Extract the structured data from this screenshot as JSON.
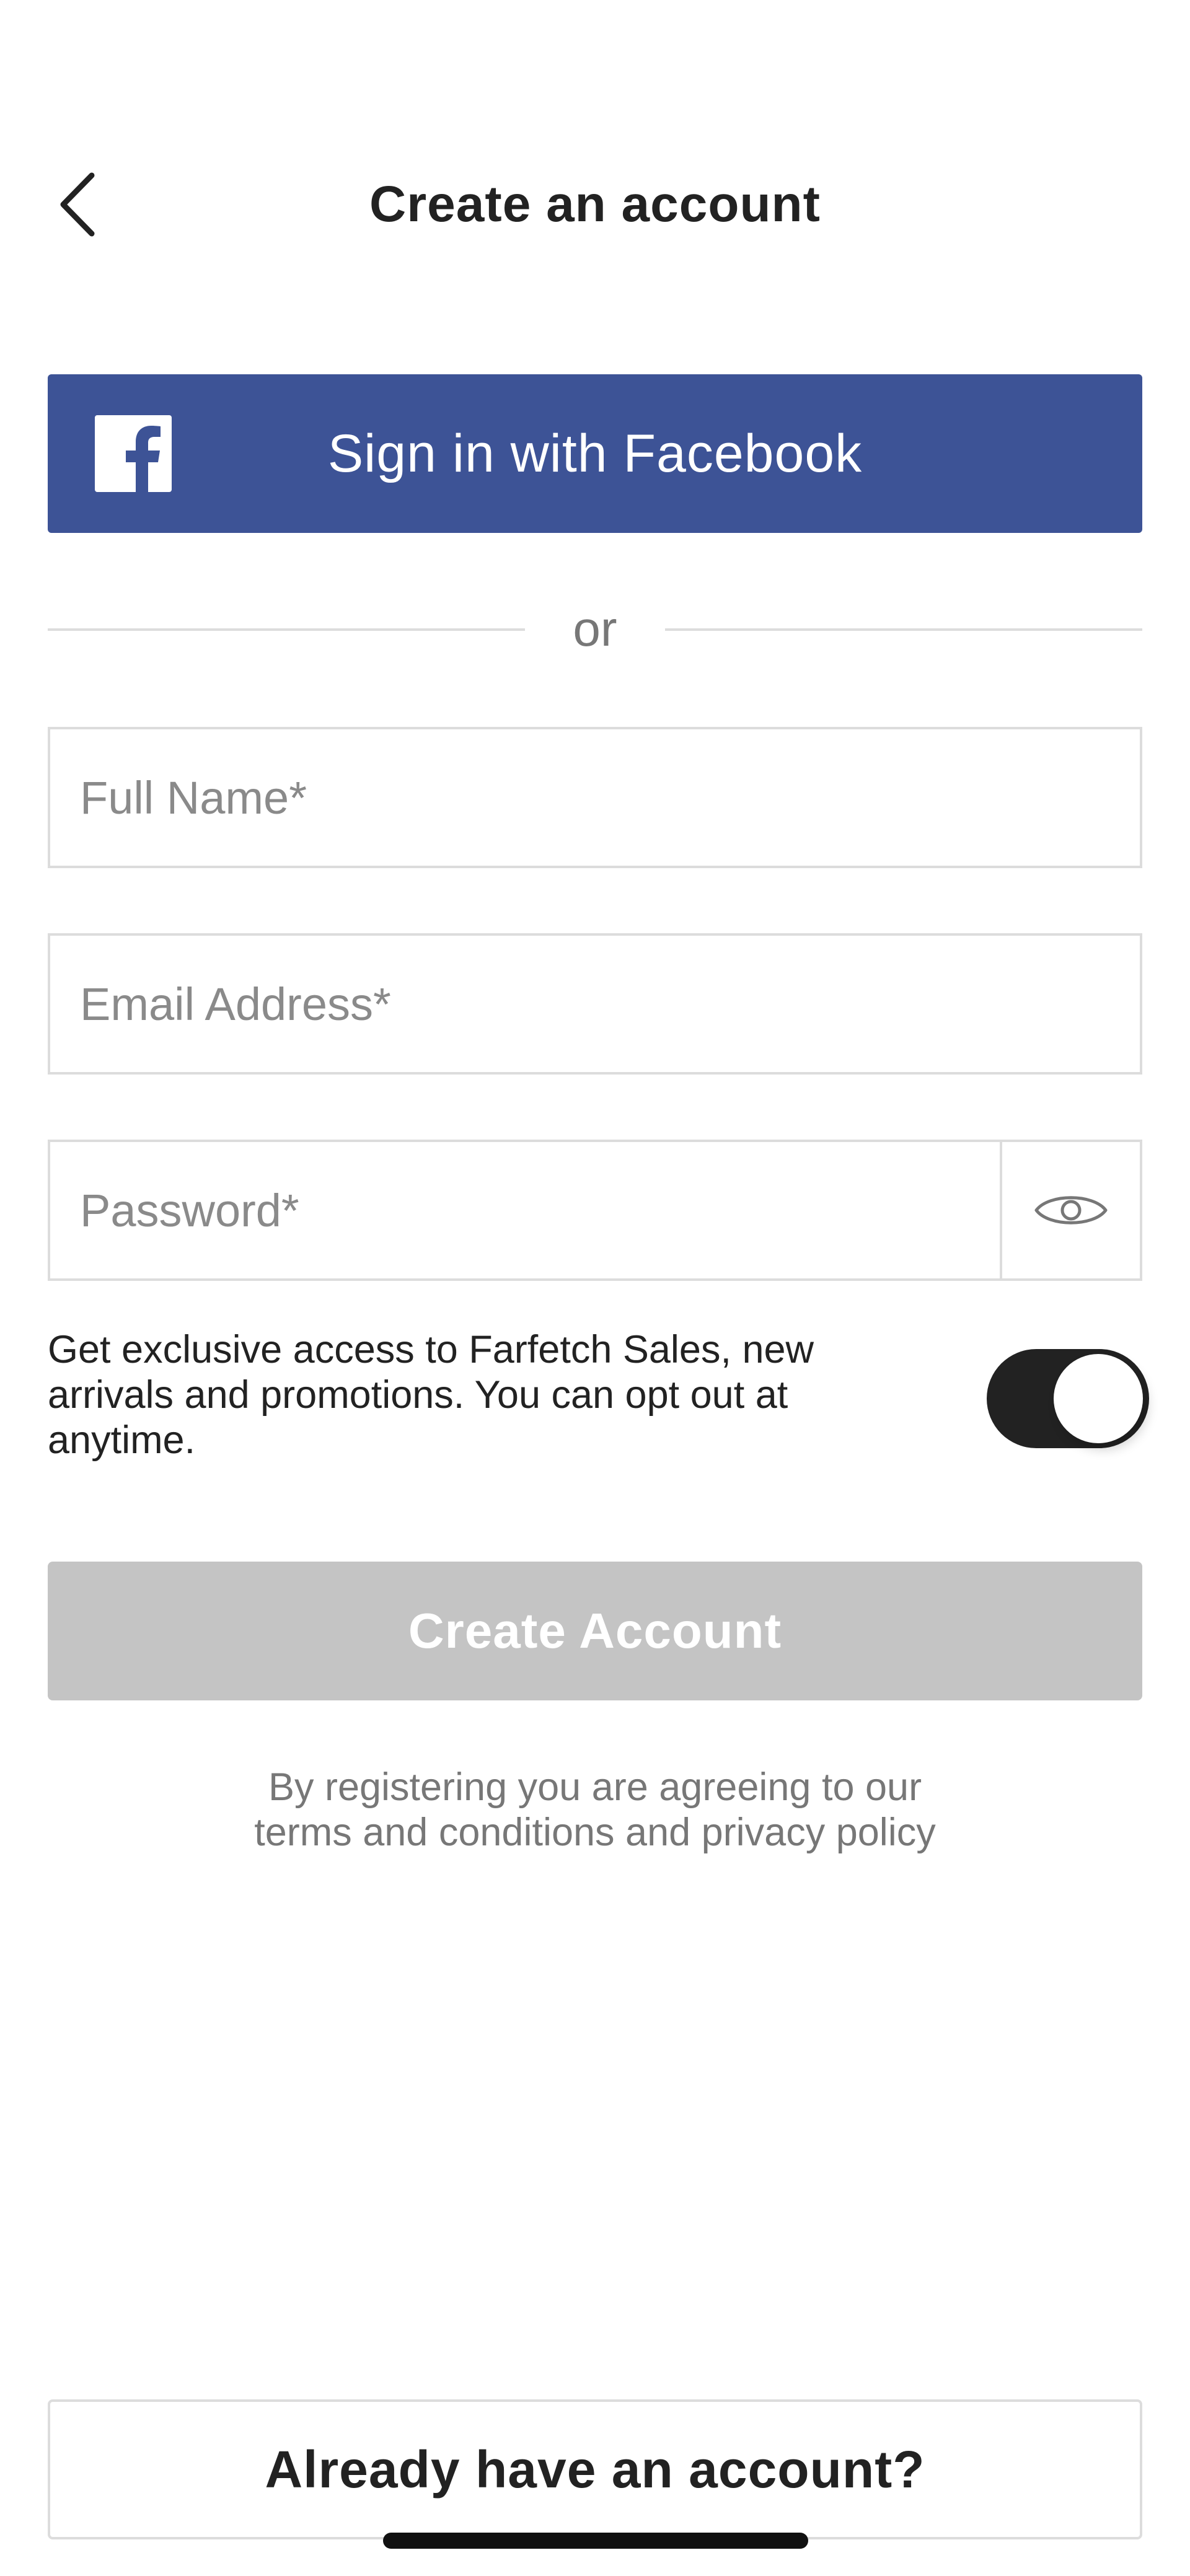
{
  "header": {
    "title": "Create an account",
    "back_icon": "chevron-left-icon"
  },
  "facebook": {
    "label": "Sign in with Facebook",
    "icon": "facebook-icon",
    "color": "#3d5396"
  },
  "divider": {
    "text": "or"
  },
  "form": {
    "full_name": {
      "placeholder": "Full Name*",
      "value": ""
    },
    "email": {
      "placeholder": "Email Address*",
      "value": ""
    },
    "password": {
      "placeholder": "Password*",
      "value": "",
      "toggle_icon": "eye-icon"
    }
  },
  "optin": {
    "text": "Get exclusive access to Farfetch Sales, new arrivals and promotions. You can opt out at anytime.",
    "enabled": true
  },
  "create_button": {
    "label": "Create Account",
    "enabled": false,
    "color": "#c4c4c4"
  },
  "terms": {
    "line1": "By registering you are agreeing to our",
    "line2": "terms and conditions and privacy policy"
  },
  "login": {
    "label": "Already have an account?"
  }
}
